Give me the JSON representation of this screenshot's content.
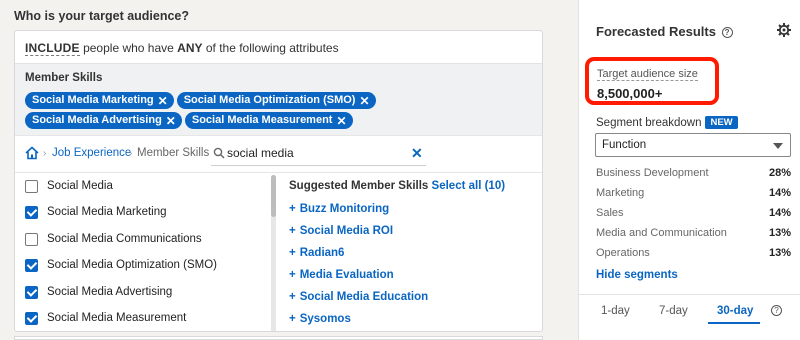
{
  "question": "Who is your target audience?",
  "include": {
    "keyword": "INCLUDE",
    "text_before_any": "people who have",
    "any_keyword": "ANY",
    "text_after_any": "of the following attributes"
  },
  "member_skills": {
    "title": "Member Skills",
    "pills": [
      "Social Media Marketing",
      "Social Media Optimization (SMO)",
      "Social Media Advertising",
      "Social Media Measurement"
    ]
  },
  "breadcrumb": {
    "job_experience": "Job Experience",
    "member_skills": "Member Skills"
  },
  "search": {
    "value": "social media",
    "placeholder": ""
  },
  "options": [
    {
      "label": "Social Media",
      "checked": false
    },
    {
      "label": "Social Media Marketing",
      "checked": true
    },
    {
      "label": "Social Media Communications",
      "checked": false
    },
    {
      "label": "Social Media Optimization (SMO)",
      "checked": true
    },
    {
      "label": "Social Media Advertising",
      "checked": true
    },
    {
      "label": "Social Media Measurement",
      "checked": true
    }
  ],
  "suggested": {
    "title": "Suggested Member Skills",
    "select_all": "Select all (10)",
    "items": [
      "Buzz Monitoring",
      "Social Media ROI",
      "Radian6",
      "Media Evaluation",
      "Social Media Education",
      "Sysomos"
    ]
  },
  "forecast": {
    "title": "Forecasted Results",
    "target_audience_label": "Target audience size",
    "target_audience_value": "8,500,000+",
    "segment_breakdown_label": "Segment breakdown",
    "new_badge": "NEW",
    "segment_select": "Function",
    "segments": [
      {
        "name": "Business Development",
        "pct": "28%"
      },
      {
        "name": "Marketing",
        "pct": "14%"
      },
      {
        "name": "Sales",
        "pct": "14%"
      },
      {
        "name": "Media and Communication",
        "pct": "13%"
      },
      {
        "name": "Operations",
        "pct": "13%"
      }
    ],
    "hide_segments": "Hide segments",
    "tabs": [
      "1-day",
      "7-day",
      "30-day"
    ],
    "active_tab": "30-day"
  },
  "colors": {
    "accent": "#0a66c2",
    "highlight": "#ff1a00",
    "background": "#f3f2ef"
  }
}
